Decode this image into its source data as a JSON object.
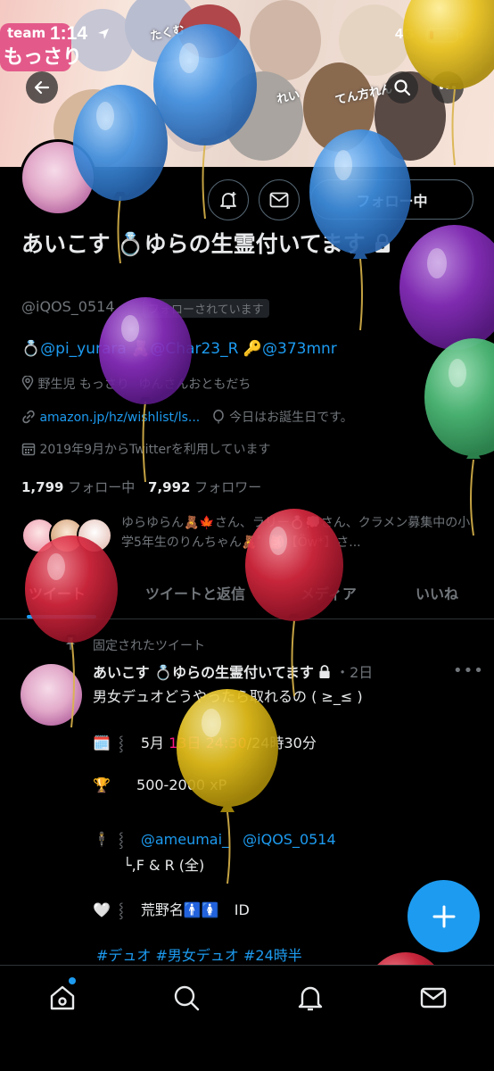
{
  "status_bar": {
    "time": "1:14",
    "network": "4G",
    "battery_level": 0.15
  },
  "banner": {
    "team_label": "team",
    "logo_text": "もっさり",
    "member_tags": [
      "たくむ",
      "れい",
      "てん方れん"
    ]
  },
  "profile": {
    "display_name": "あいこす 💍ゆらの生霊付いてます",
    "handle": "@iQOS_0514",
    "follows_you": "フォローされています",
    "follow_button": "フォロー中",
    "bio": {
      "m1": "@pi_yurara",
      "m2": "@Char23_R",
      "m3": "@373mnr"
    },
    "location": "野生児  もっさり",
    "location_extra": "ゆんさんおともだち",
    "website": "amazon.jp/hz/wishlist/ls...",
    "birthday": "今日はお誕生日です。",
    "joined": "2019年9月からTwitterを利用しています",
    "following_count": "1,799",
    "following_label": "フォロー中",
    "followers_count": "7,992",
    "followers_label": "フォロワー",
    "followed_by": "ゆらゆらん🧸🍁さん、ラリー💍💭さん、クラメン募集中の小学5年生のりんちゃん🧸゜🎒【Öw*】さ..."
  },
  "tabs": [
    "ツイート",
    "ツイートと返信",
    "メディア",
    "いいね"
  ],
  "active_tab": 0,
  "pinned_label": "固定されたツイート",
  "tweet": {
    "name": "あいこす 💍ゆらの生霊付いてます",
    "time": "・2日",
    "line1": "男女デュオどうやったら取れるの ( ≥_≤ )",
    "date_a": "5月",
    "date_b": "13日",
    "date_c": "24:30",
    "date_d": "/24時30分",
    "score": "500-2000 xP",
    "mention1": "@ameumai_",
    "mention2": "@iQOS_0514",
    "mode": "└,F & R (全)",
    "venue": "荒野名🚹🚺",
    "venue_id": "ID",
    "hashtags": "#デュオ  #男女デュオ  #24時半"
  },
  "colors": {
    "accent": "#1d9bf0",
    "balloon_blue": "#3f8fe0",
    "balloon_purple": "#8a2fbf",
    "balloon_green": "#4fbf7a",
    "balloon_red": "#d8293f",
    "balloon_yellow": "#e8c21c"
  },
  "icons": [
    "back-arrow-icon",
    "search-icon",
    "notification-bell-icon",
    "mail-icon",
    "lock-icon",
    "location-pin-icon",
    "link-icon",
    "balloon-icon",
    "calendar-icon",
    "pin-icon",
    "more-icon",
    "compose-plus-icon",
    "home-icon",
    "notifications-icon",
    "messages-icon"
  ]
}
